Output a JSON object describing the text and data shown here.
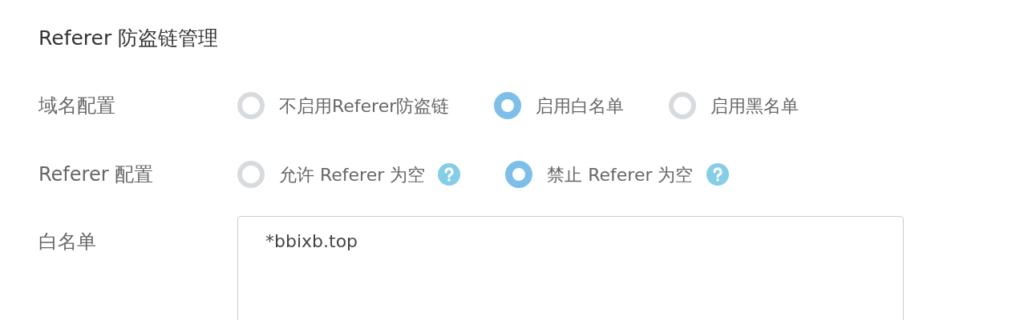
{
  "title": "Referer 防盗链管理",
  "rows": [
    {
      "label": "域名配置",
      "options": [
        {
          "label": "不启用Referer防盗链",
          "selected": false,
          "help": false
        },
        {
          "label": "启用白名单",
          "selected": true,
          "help": false
        },
        {
          "label": "启用黑名单",
          "selected": false,
          "help": false
        }
      ]
    },
    {
      "label": "Referer 配置",
      "options": [
        {
          "label": "允许 Referer 为空",
          "selected": false,
          "help": true
        },
        {
          "label": "禁止 Referer 为空",
          "selected": true,
          "help": true
        }
      ]
    }
  ],
  "whitelist": {
    "label": "白名单",
    "value": "*bbixb.top"
  }
}
